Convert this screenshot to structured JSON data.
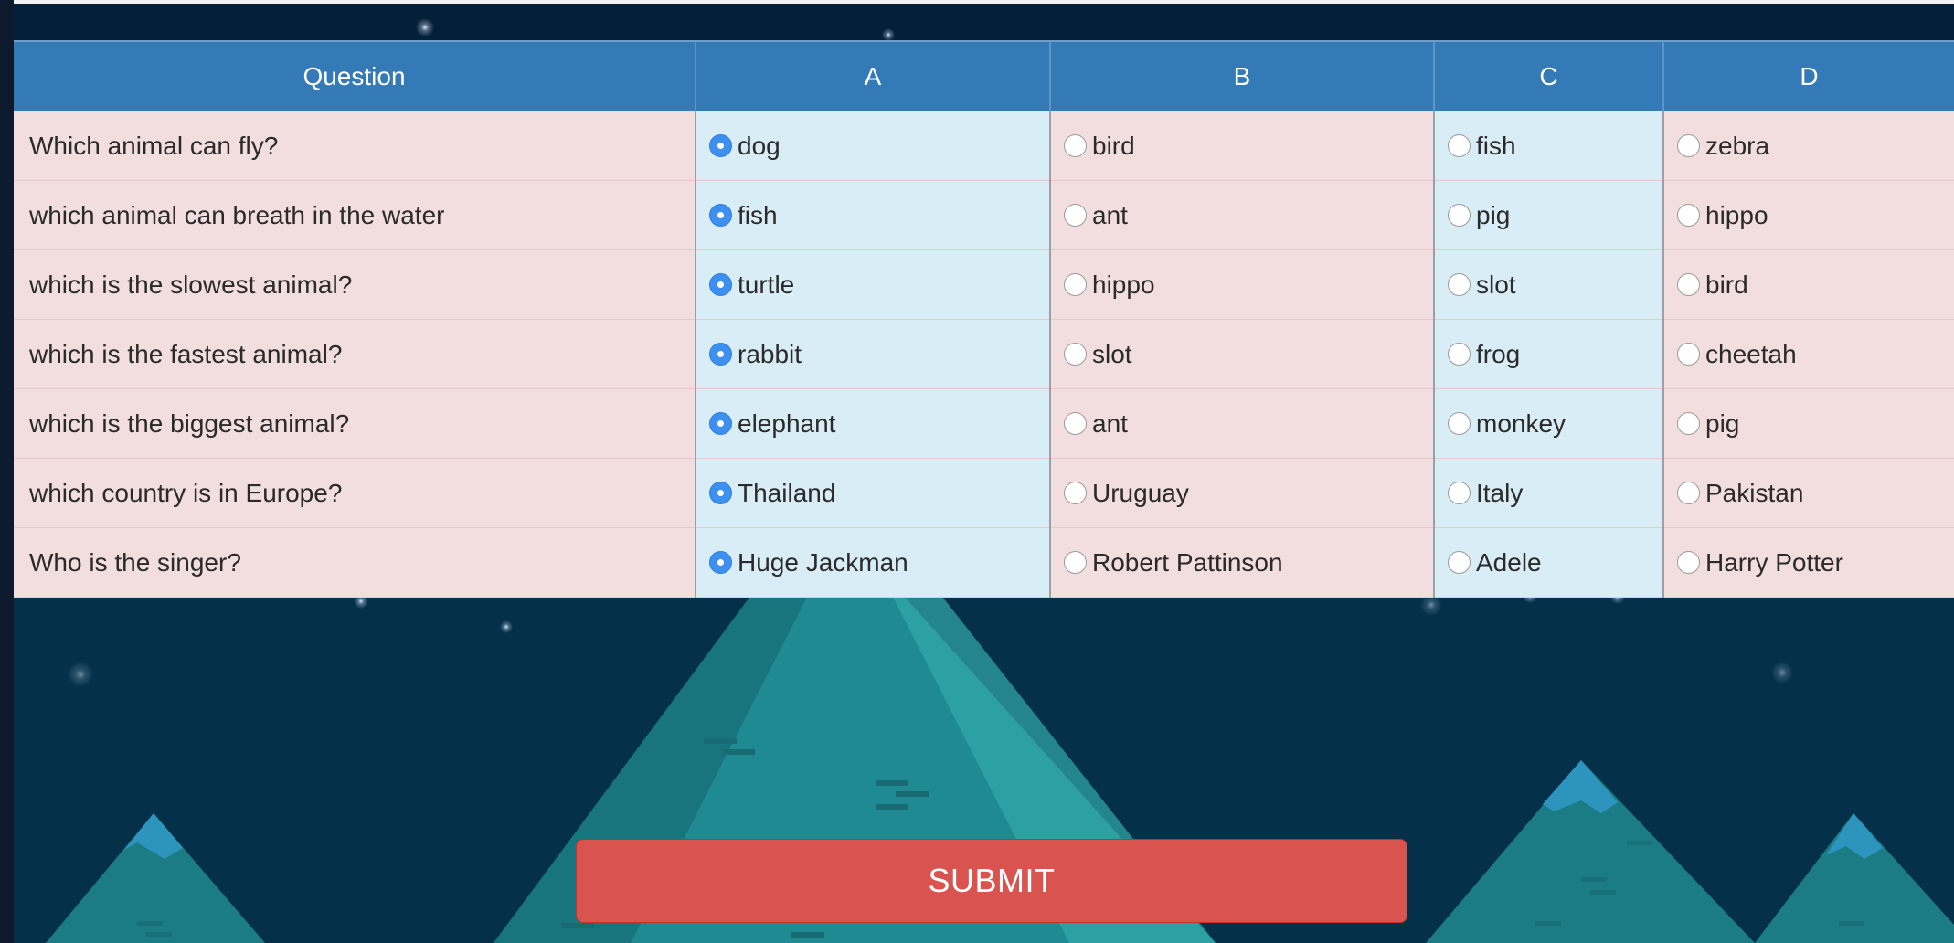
{
  "colors": {
    "background": "#04304a",
    "header": "#337ab7",
    "question_cell": "#f2dede",
    "option_cell_blue": "#d9edf7",
    "radio_selected": "#3d8ff0",
    "submit": "#d9534f"
  },
  "table": {
    "headers": [
      "Question",
      "A",
      "B",
      "C",
      "D"
    ],
    "rows": [
      {
        "question": "Which animal can fly?",
        "a": "dog",
        "b": "bird",
        "c": "fish",
        "d": "zebra"
      },
      {
        "question": "which animal can breath in the water",
        "a": "fish",
        "b": "ant",
        "c": "pig",
        "d": "hippo"
      },
      {
        "question": "which is the slowest animal?",
        "a": "turtle",
        "b": "hippo",
        "c": "slot",
        "d": "bird"
      },
      {
        "question": "which is the fastest animal?",
        "a": "rabbit",
        "b": "slot",
        "c": "frog",
        "d": "cheetah"
      },
      {
        "question": "which is the biggest animal?",
        "a": "elephant",
        "b": "ant",
        "c": "monkey",
        "d": "pig"
      },
      {
        "question": "which country is in Europe?",
        "a": "Thailand",
        "b": "Uruguay",
        "c": "Italy",
        "d": "Pakistan"
      },
      {
        "question": "Who is the singer?",
        "a": "Huge Jackman",
        "b": "Robert Pattinson",
        "c": "Adele",
        "d": "Harry Potter"
      }
    ],
    "selected_option": "a"
  },
  "submit": {
    "label": "SUBMIT"
  }
}
